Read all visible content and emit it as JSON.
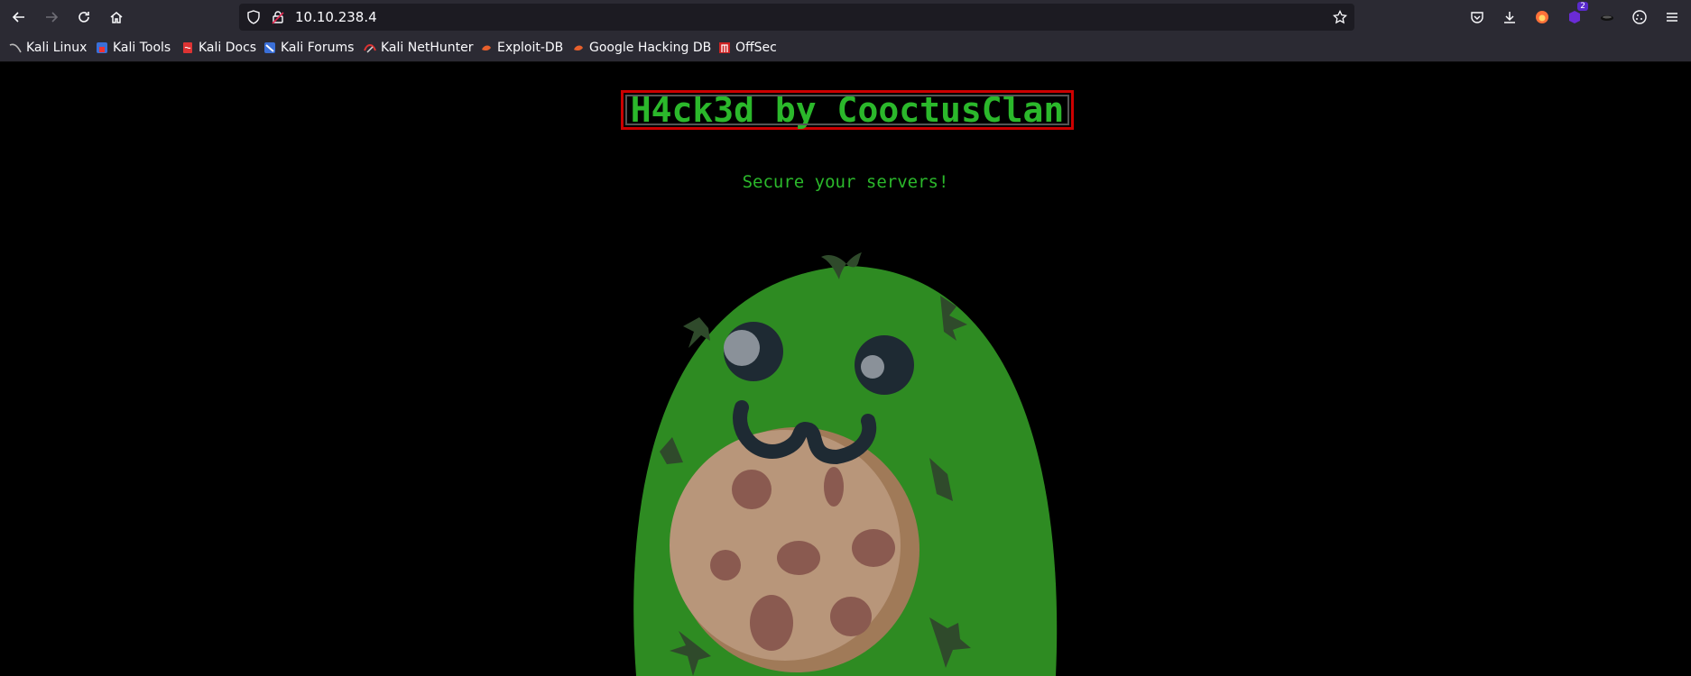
{
  "browser": {
    "url": "10.10.238.4",
    "extension_badge": "2"
  },
  "bookmarks": [
    {
      "label": "Kali Linux",
      "icon": "kali-dragon-icon"
    },
    {
      "label": "Kali Tools",
      "icon": "kali-tools-icon"
    },
    {
      "label": "Kali Docs",
      "icon": "kali-docs-icon"
    },
    {
      "label": "Kali Forums",
      "icon": "kali-forums-icon"
    },
    {
      "label": "Kali NetHunter",
      "icon": "nethunter-icon"
    },
    {
      "label": "Exploit-DB",
      "icon": "exploit-db-icon"
    },
    {
      "label": "Google Hacking DB",
      "icon": "ghdb-icon"
    },
    {
      "label": "OffSec",
      "icon": "offsec-icon"
    }
  ],
  "page": {
    "heading": "H4ck3d by CooctusClan",
    "subtitle": "Secure your servers!"
  },
  "colors": {
    "chrome": "#2b2a33",
    "urlbar": "#1c1b22",
    "accent_green": "#2bb82b",
    "mascot_green": "#2e8b22",
    "border_red": "#cc0000"
  }
}
